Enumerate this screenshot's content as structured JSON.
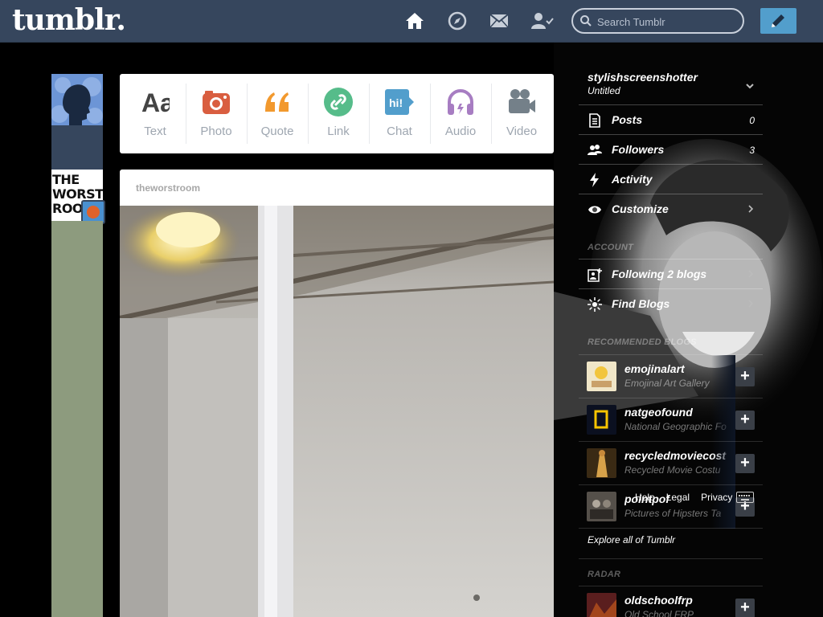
{
  "header": {
    "logo": "tumblr.",
    "search_placeholder": "Search Tumblr",
    "nav": [
      "home-icon",
      "explore-icon",
      "inbox-icon",
      "account-icon"
    ],
    "compose": "pencil-icon",
    "bg_color": "#36465d",
    "accent": "#529ecc"
  },
  "post_types": [
    {
      "label": "Text",
      "icon": "text-icon",
      "color": "#444444"
    },
    {
      "label": "Photo",
      "icon": "camera-icon",
      "color": "#d95e40"
    },
    {
      "label": "Quote",
      "icon": "quote-icon",
      "color": "#f2992e"
    },
    {
      "label": "Link",
      "icon": "link-icon",
      "color": "#56bc8a"
    },
    {
      "label": "Chat",
      "icon": "chat-icon",
      "color": "#529ecc"
    },
    {
      "label": "Audio",
      "icon": "headphones-icon",
      "color": "#a77dc2"
    },
    {
      "label": "Video",
      "icon": "video-camera-icon",
      "color": "#748089"
    }
  ],
  "left": {
    "blog_avatar_text": "THE WORST ROO"
  },
  "post": {
    "author": "theworstroom"
  },
  "sidebar": {
    "blog_name": "stylishscreenshotter",
    "blog_title": "Untitled",
    "rows": [
      {
        "label": "Posts",
        "count": "0",
        "icon": "document-icon"
      },
      {
        "label": "Followers",
        "count": "3",
        "icon": "people-icon"
      },
      {
        "label": "Activity",
        "count": "",
        "icon": "lightning-icon"
      },
      {
        "label": "Customize",
        "count": "",
        "icon": "eye-icon"
      }
    ],
    "account_heading": "ACCOUNT",
    "account_rows": [
      {
        "label": "Following 2 blogs",
        "icon": "following-icon"
      },
      {
        "label": "Find Blogs",
        "icon": "sunburst-icon"
      }
    ],
    "recommended_heading": "RECOMMENDED BLOGS",
    "recommended": [
      {
        "name": "emojinalart",
        "subtitle": "Emojinal Art Gallery"
      },
      {
        "name": "natgeofound",
        "subtitle": "National Geographic Fo"
      },
      {
        "name": "recycledmoviecost",
        "subtitle": "Recycled Movie Costu"
      },
      {
        "name": "pointpof",
        "subtitle": "Pictures of Hipsters Ta"
      }
    ],
    "footer_links": [
      "Help",
      "Legal",
      "Privacy"
    ],
    "explore": "Explore all of Tumblr",
    "radar_heading": "RADAR",
    "radar": {
      "name": "oldschoolfrp",
      "subtitle": "Old School FRP"
    }
  }
}
